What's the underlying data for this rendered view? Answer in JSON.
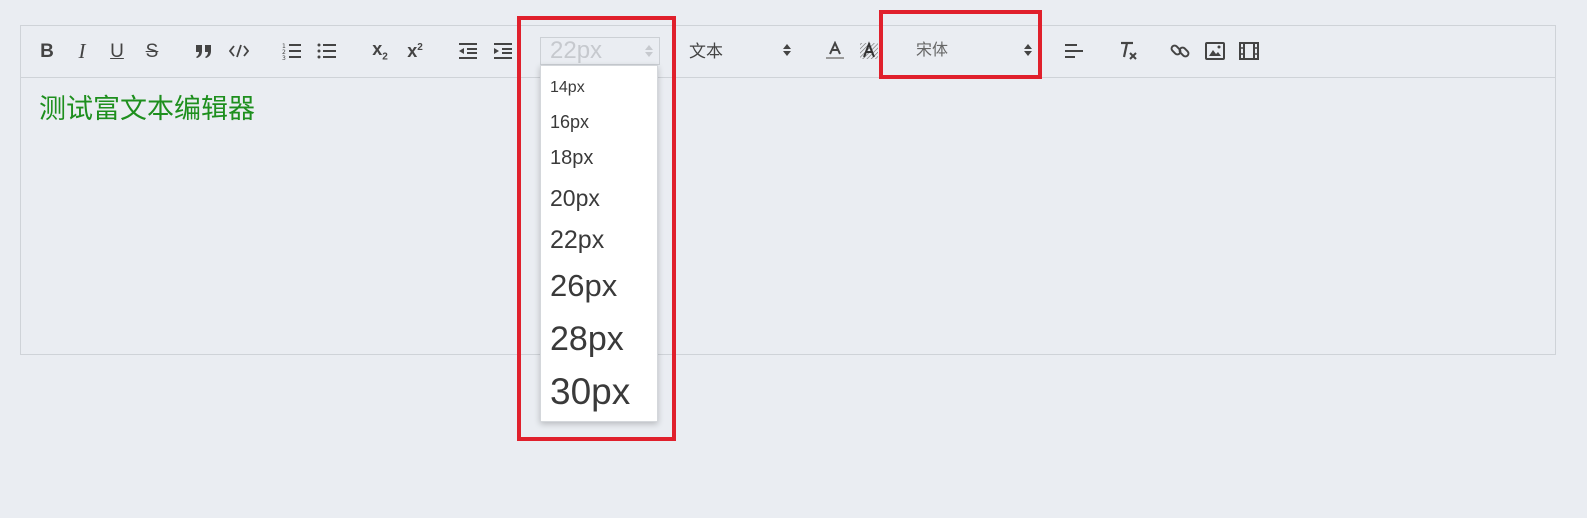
{
  "toolbar": {
    "bold_label": "B",
    "italic_label": "I",
    "underline_label": "U",
    "strike_label": "S",
    "sub_label": "x",
    "sub_mark": "2",
    "sup_label": "x",
    "sup_mark": "2",
    "size_value": "22px",
    "header_value": "文本",
    "font_value": "宋体",
    "icons": [
      "bold-icon",
      "italic-icon",
      "underline-icon",
      "strike-icon",
      "blockquote-icon",
      "code-block-icon",
      "ordered-list-icon",
      "bullet-list-icon",
      "subscript-icon",
      "superscript-icon",
      "outdent-icon",
      "indent-icon",
      "text-color-icon",
      "background-color-icon",
      "align-left-icon",
      "clear-format-icon",
      "link-icon",
      "image-icon",
      "video-icon"
    ]
  },
  "size_options": [
    "14px",
    "16px",
    "18px",
    "20px",
    "22px",
    "26px",
    "28px",
    "30px"
  ],
  "editor": {
    "content_text": "测试富文本编辑器"
  },
  "colors": {
    "highlight": "#e0202c",
    "content_text": "#1e8f1e",
    "background": "#eaedf2"
  }
}
